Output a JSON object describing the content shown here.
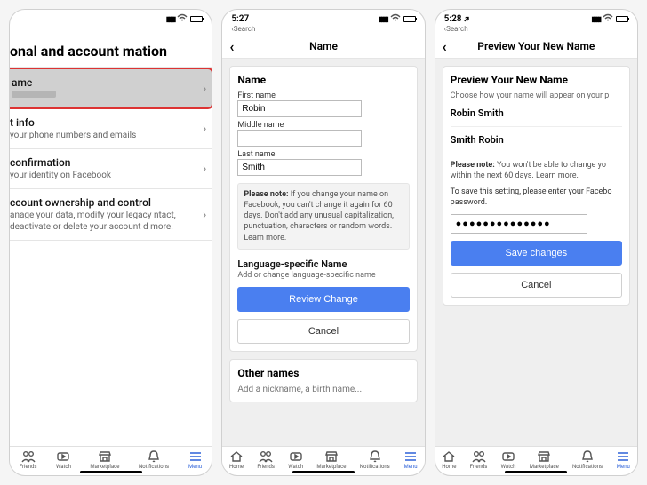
{
  "status": {
    "time2": "5:27",
    "time3": "5:28",
    "search_back": "Search"
  },
  "screen1": {
    "title": "onal and account mation",
    "name_label": "ame",
    "contact_label": "t info",
    "contact_sub": "your phone numbers and emails",
    "identity_label": "confirmation",
    "identity_sub": "your identity on Facebook",
    "ownership_label": "ccount ownership and control",
    "ownership_sub": "anage your data, modify your legacy ntact, deactivate or delete your account d more."
  },
  "screen2": {
    "header": "Name",
    "section": "Name",
    "first_lab": "First name",
    "first_val": "Robin",
    "middle_lab": "Middle name",
    "middle_val": "",
    "last_lab": "Last name",
    "last_val": "Smith",
    "note_b": "Please note:",
    "note": " If you change your name on Facebook, you can't change it again for 60 days. Don't add any unusual capitalization, punctuation, characters or random words. Learn more.",
    "lang_head": "Language-specific Name",
    "lang_sub": "Add or change language-specific name",
    "review_btn": "Review Change",
    "cancel_btn": "Cancel",
    "other_head": "Other names",
    "other_sub": "Add a nickname, a birth name..."
  },
  "screen3": {
    "header": "Preview Your New Name",
    "section": "Preview Your New Name",
    "choose": "Choose how your name will appear on your p",
    "opt1": "Robin Smith",
    "opt2": "Smith Robin",
    "note_b": "Please note:",
    "note": " You won't be able to change yo within the next 60 days. Learn more.",
    "save_prompt": "To save this setting, please enter your Facebo password.",
    "pwd_val": "●●●●●●●●●●●●●●",
    "save_btn": "Save changes",
    "cancel_btn": "Cancel"
  },
  "tabs": {
    "home": "Home",
    "friends": "Friends",
    "watch": "Watch",
    "marketplace": "Marketplace",
    "notifications": "Notifications",
    "menu": "Menu"
  }
}
